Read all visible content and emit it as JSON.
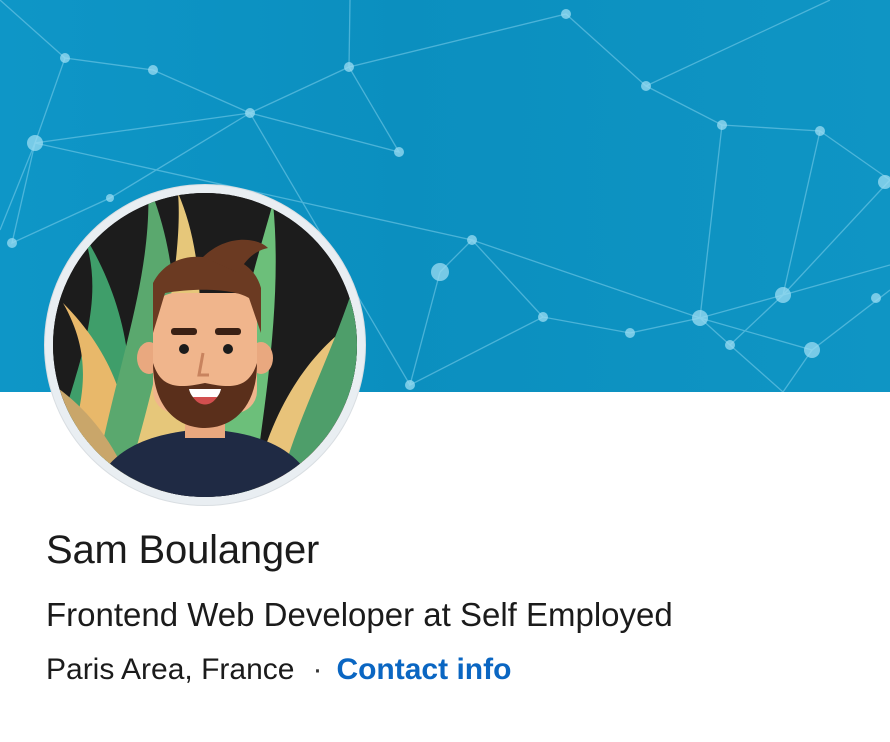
{
  "profile": {
    "name": "Sam Boulanger",
    "headline": "Frontend Web Developer at Self Employed",
    "location": "Paris Area, France",
    "separator": "·",
    "contact_label": "Contact info"
  },
  "colors": {
    "cover": "#0b8fbf",
    "contact_link": "#0a66c2",
    "text": "#1b1b1b"
  },
  "icons": {
    "avatar": "cartoon-bearded-man-avatar"
  }
}
